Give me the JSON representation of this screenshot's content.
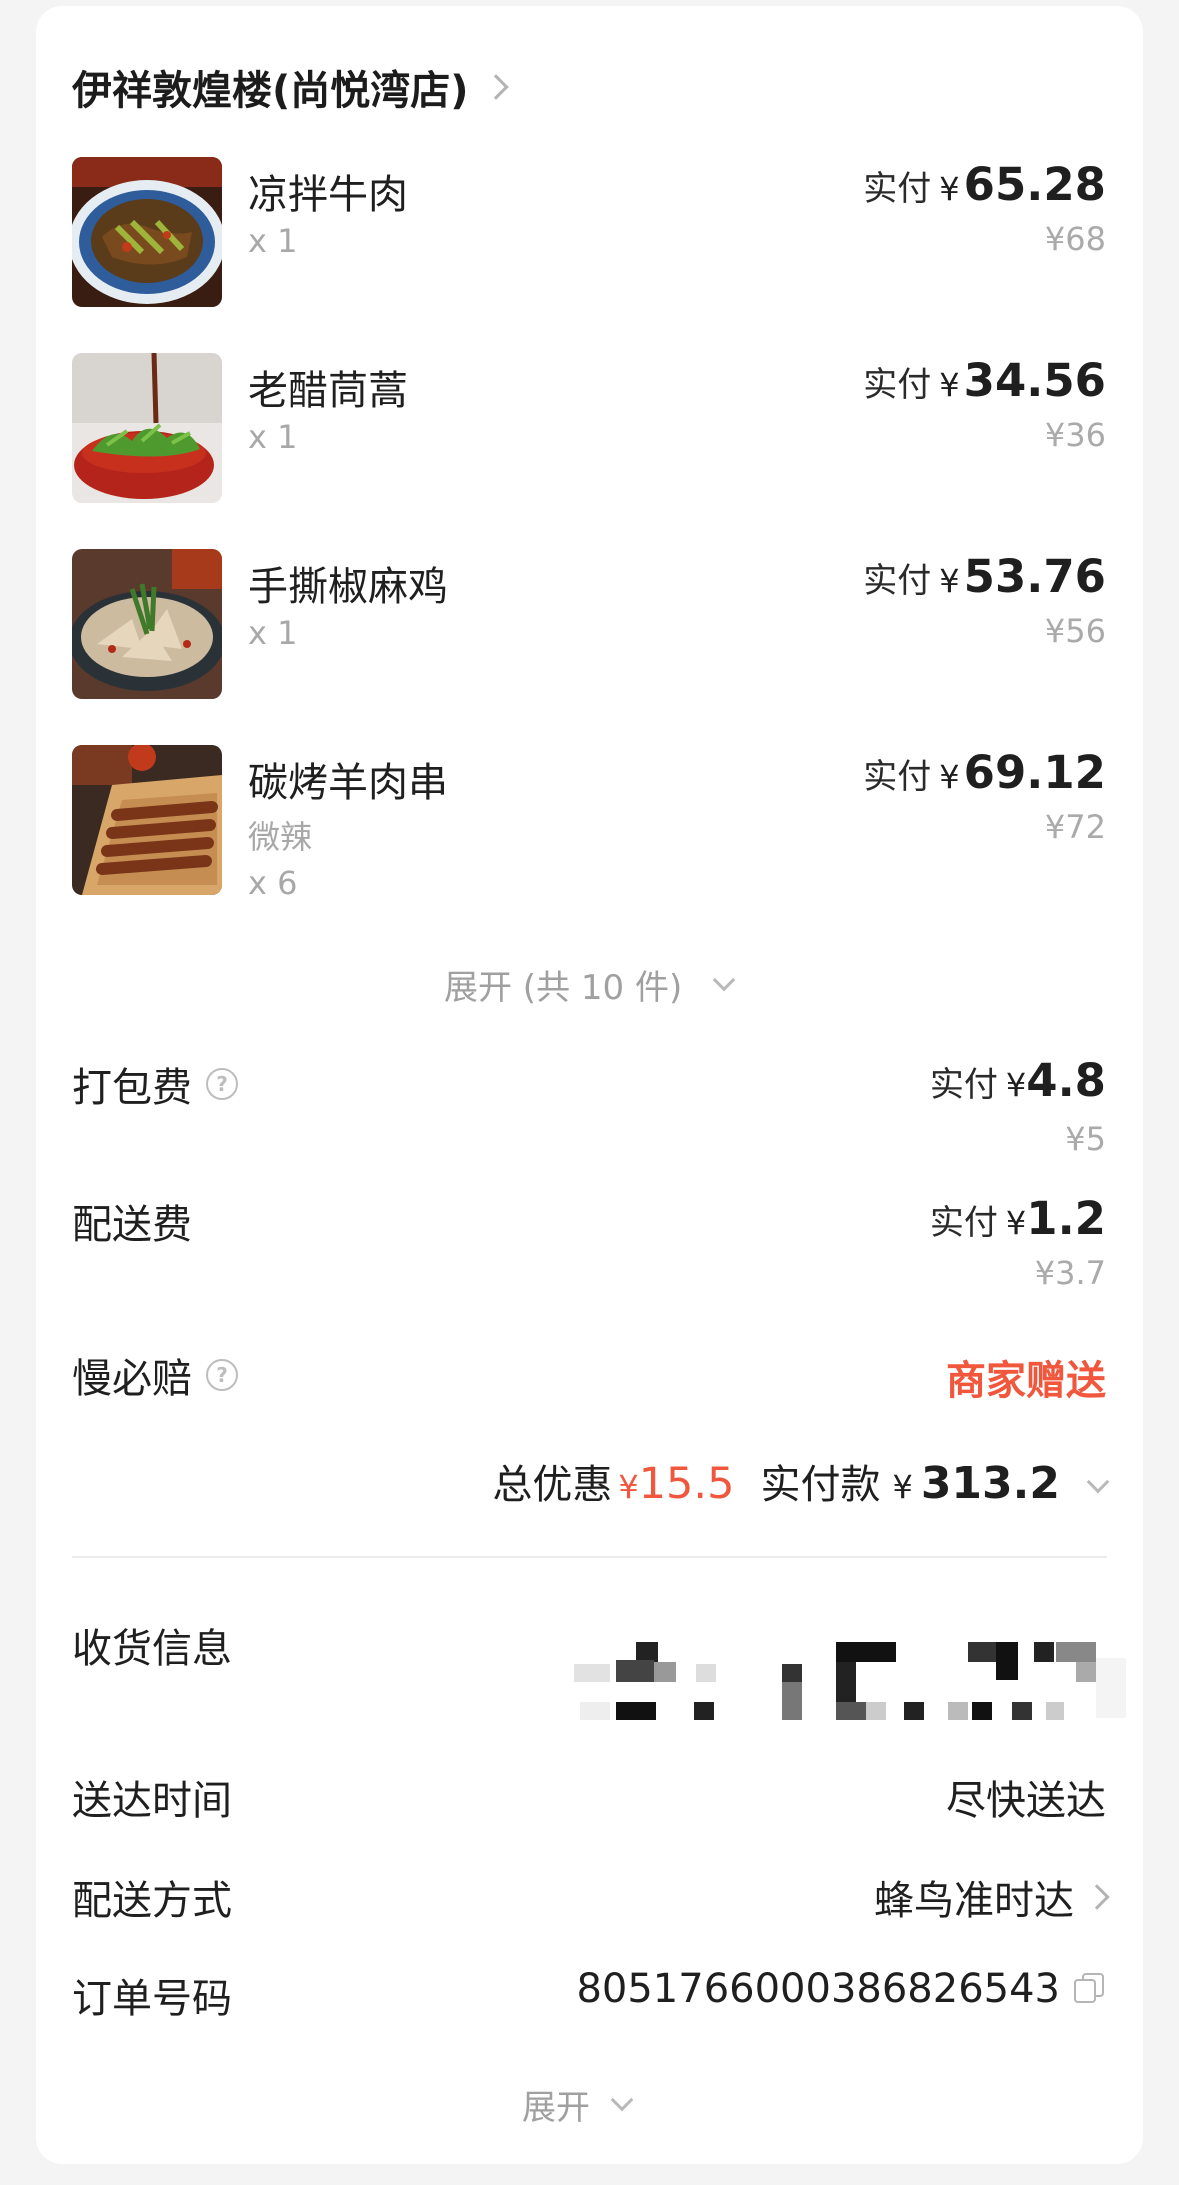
{
  "store": {
    "name": "伊祥敦煌楼(尚悦湾店)"
  },
  "items": [
    {
      "name": "凉拌牛肉",
      "spec": "",
      "qty": "x 1",
      "paid_label": "实付",
      "yen": "¥",
      "paid": "65.28",
      "original": "¥68",
      "image": "cold-beef-dish-photo"
    },
    {
      "name": "老醋茼蒿",
      "spec": "",
      "qty": "x 1",
      "paid_label": "实付",
      "yen": "¥",
      "paid": "34.56",
      "original": "¥36",
      "image": "vinegar-greens-dish-photo"
    },
    {
      "name": "手撕椒麻鸡",
      "spec": "",
      "qty": "x 1",
      "paid_label": "实付",
      "yen": "¥",
      "paid": "53.76",
      "original": "¥56",
      "image": "pepper-chicken-dish-photo"
    },
    {
      "name": "碳烤羊肉串",
      "spec": "微辣",
      "qty": "x 6",
      "paid_label": "实付",
      "yen": "¥",
      "paid": "69.12",
      "original": "¥72",
      "image": "lamb-skewers-photo"
    }
  ],
  "expand_items": "展开 (共 10 件)",
  "fees": {
    "packing": {
      "label": "打包费",
      "paid_label": "实付",
      "yen": "¥",
      "paid": "4.8",
      "original": "¥5"
    },
    "delivery": {
      "label": "配送费",
      "paid_label": "实付",
      "yen": "¥",
      "paid": "1.2",
      "original": "¥3.7"
    },
    "late_comp": {
      "label": "慢必赔",
      "value": "商家赠送"
    }
  },
  "totals": {
    "discount_label": "总优惠",
    "discount_yen": "¥",
    "discount": "15.5",
    "paid_label": "实付款",
    "paid_yen": "¥",
    "paid": "313.2"
  },
  "info": {
    "address_label": "收货信息",
    "time_label": "送达时间",
    "time_value": "尽快送达",
    "method_label": "配送方式",
    "method_value": "蜂鸟准时达",
    "order_label": "订单号码",
    "order_value": "8051766000386826543"
  },
  "expand_more": "展开",
  "colors": {
    "accent_red": "#f0573c",
    "muted": "#aaaaaa",
    "text": "#1f1f1f"
  }
}
